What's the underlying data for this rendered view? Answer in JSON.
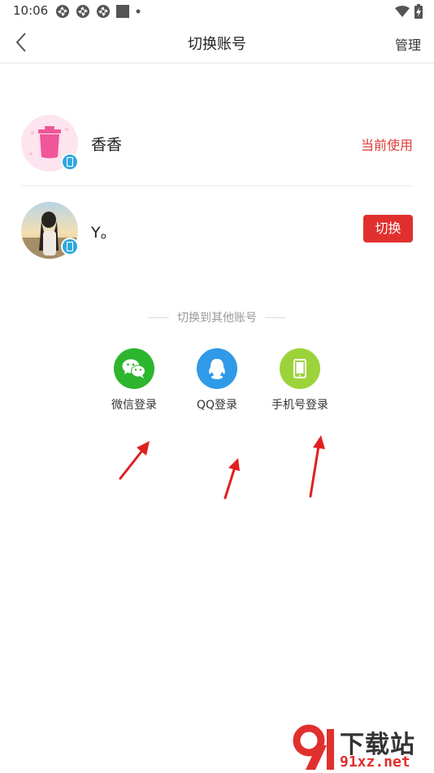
{
  "status_bar": {
    "time": "10:06",
    "icons_left": [
      "app-notification-icon",
      "app-notification-icon",
      "app-notification-icon",
      "image-notification-icon",
      "dot-icon"
    ],
    "icons_right": [
      "wifi-icon",
      "battery-charging-icon"
    ]
  },
  "nav": {
    "back_icon": "chevron-left-icon",
    "title": "切换账号",
    "manage_label": "管理"
  },
  "accounts": [
    {
      "name": "香香",
      "status_label": "当前使用",
      "avatar": "pink-trash-avatar",
      "device_icon": "phone-badge-icon",
      "is_current": true
    },
    {
      "name": "Y。",
      "action_label": "切换",
      "avatar": "photo-avatar",
      "device_icon": "phone-badge-icon",
      "is_current": false
    }
  ],
  "other_login": {
    "title": "切换到其他账号",
    "options": [
      {
        "label": "微信登录",
        "icon": "wechat-icon",
        "color": "#2db52e"
      },
      {
        "label": "QQ登录",
        "icon": "qq-icon",
        "color": "#2f9ae8"
      },
      {
        "label": "手机号登录",
        "icon": "phone-icon",
        "color": "#9cd33a"
      }
    ]
  },
  "watermark": {
    "text_top": "下载站",
    "text_bottom": "91xz.net"
  },
  "colors": {
    "accent_red": "#e0302e",
    "divider": "#e3e3e3",
    "badge_blue": "#2ea7e0"
  }
}
